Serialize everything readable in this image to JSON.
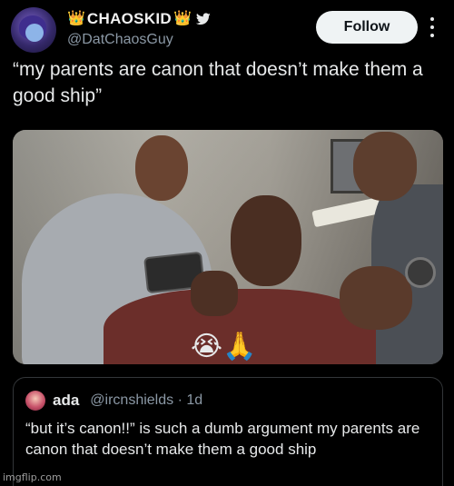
{
  "tweet": {
    "author": {
      "display_name": "CHAOSKID",
      "crown_left": "👑",
      "crown_right": "👑",
      "handle": "@DatChaosGuy"
    },
    "follow_label": "Follow",
    "text": "“my parents are canon that doesn’t make them a good ship”",
    "media": {
      "emojis": "😭🙏"
    }
  },
  "quoted_tweet": {
    "name": "ada",
    "meta": "@ircnshields · 1d",
    "text": "“but it’s canon!!” is such a dumb argument my parents are canon that doesn’t make them a good ship"
  },
  "watermark": "imgflip.com",
  "colors": {
    "background": "#000000",
    "text_primary": "#e7e9ea",
    "text_secondary": "#8b98a5",
    "follow_button_bg": "#eff3f4",
    "border": "#333639"
  },
  "icons": [
    "avatar",
    "twitter-bird-icon",
    "more-options-icon",
    "quoted-avatar"
  ]
}
